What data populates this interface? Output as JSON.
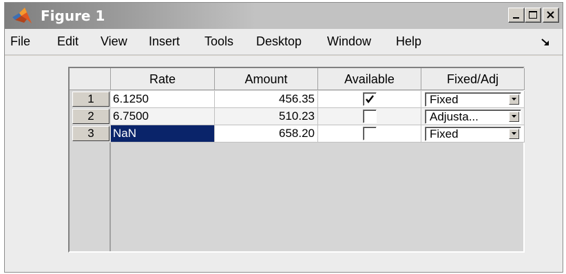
{
  "window": {
    "title": "Figure 1"
  },
  "menu": [
    "File",
    "Edit",
    "View",
    "Insert",
    "Tools",
    "Desktop",
    "Window",
    "Help"
  ],
  "table": {
    "columns": [
      "Rate",
      "Amount",
      "Available",
      "Fixed/Adj"
    ],
    "rows": [
      {
        "index": "1",
        "rate": "6.1250",
        "amount": "456.35",
        "available": true,
        "type": "Fixed"
      },
      {
        "index": "2",
        "rate": "6.7500",
        "amount": "510.23",
        "available": false,
        "type": "Adjusta..."
      },
      {
        "index": "3",
        "rate": "NaN",
        "amount": "658.20",
        "available": false,
        "type": "Fixed"
      }
    ],
    "selected_cell": {
      "row": 3,
      "column": "Rate"
    }
  },
  "colors": {
    "selection": "#0a246a",
    "titlebar_start": "#7f7f7f",
    "window_bg": "#d4d0c8"
  },
  "icons": [
    "matlab-logo-icon",
    "minimize-icon",
    "maximize-icon",
    "close-icon",
    "dock-arrow-icon",
    "checkmark-icon",
    "dropdown-arrow-icon"
  ]
}
